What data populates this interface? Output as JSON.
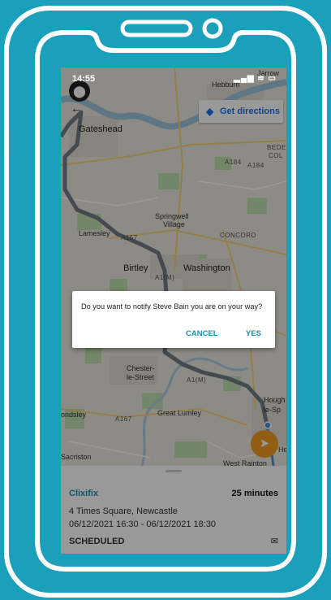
{
  "status_bar": {
    "time": "14:55",
    "location_icon": "arrow-icon",
    "icons": "▂▄▆ ≋ ▭"
  },
  "map": {
    "labels": {
      "jarrow": "Jarrow",
      "hebburn": "Hebburn",
      "gateshead": "Gateshead",
      "springwell": "Springwell",
      "village": "Village",
      "lamesley": "Lamesley",
      "concord": "CONCORD",
      "birtley": "Birtley",
      "washington": "Washington",
      "a1m_1": "A1(M)",
      "chester": "Chester-",
      "le_street": "le-Street",
      "a1m_2": "A1(M)",
      "houghton": "Hough",
      "le_spring": "le-Sp",
      "great_lumley": "Great Lumley",
      "ondsley": "ondsley",
      "a167": "A167",
      "sacriston": "Sacriston",
      "west_rainton": "West Rainton",
      "he": "He",
      "a184": "A184",
      "a184b": "A184",
      "a167b": "A167",
      "bede": "BEDE",
      "col": "COL"
    },
    "route_color": "#6f7b84",
    "route_color_light": "#8a97a1"
  },
  "get_directions": {
    "label": "Get directions",
    "icon": "navigation-diamond-icon"
  },
  "dialog": {
    "message": "Do you want to notify Steve Bain you are on your way?",
    "cancel_label": "CANCEL",
    "yes_label": "YES"
  },
  "job": {
    "company": "Clixifix",
    "duration": "25 minutes",
    "address": "4 Times Square, Newcastle",
    "time_range": "06/12/2021 16:30 - 06/12/2021 18:30",
    "status": "SCHEDULED",
    "mail_icon": "mail-icon"
  },
  "colors": {
    "background": "#1aa0bb",
    "accent": "#1b8fb0",
    "fab": "#f29c1f"
  }
}
